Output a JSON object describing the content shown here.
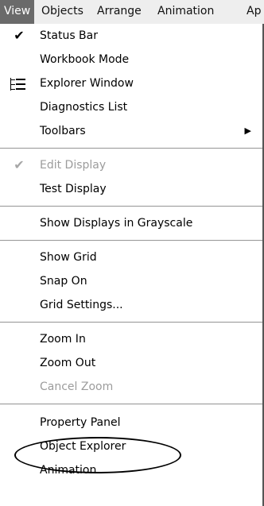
{
  "menubar": {
    "items": [
      "View",
      "Objects",
      "Arrange",
      "Animation",
      "Ap"
    ]
  },
  "menu": {
    "status_bar": "Status Bar",
    "workbook_mode": "Workbook Mode",
    "explorer_window": "Explorer Window",
    "diagnostics_list": "Diagnostics List",
    "toolbars": "Toolbars",
    "edit_display": "Edit Display",
    "test_display": "Test Display",
    "show_displays_grayscale": "Show Displays in Grayscale",
    "show_grid": "Show Grid",
    "snap_on": "Snap On",
    "grid_settings": "Grid Settings...",
    "zoom_in": "Zoom In",
    "zoom_out": "Zoom Out",
    "cancel_zoom": "Cancel Zoom",
    "property_panel": "Property Panel",
    "object_explorer": "Object Explorer",
    "animation": "Animation"
  },
  "icons": {
    "check": "check-icon",
    "explorer": "tree-view-icon",
    "submenu": "submenu-arrow-icon"
  }
}
